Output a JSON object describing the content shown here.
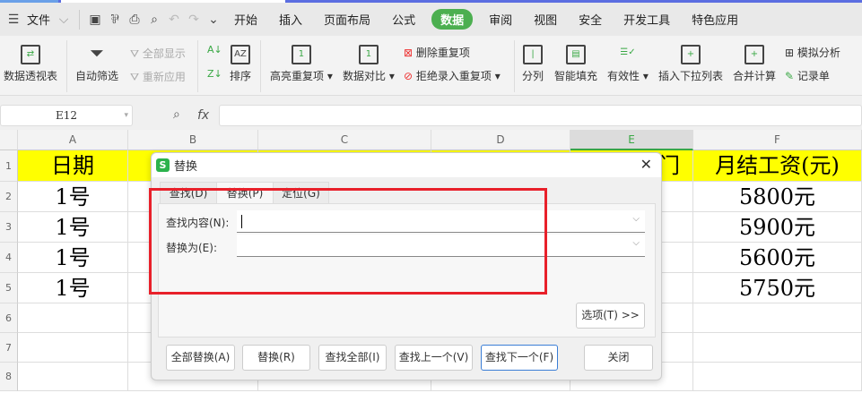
{
  "menubar": {
    "file": "文件",
    "tabs": [
      "开始",
      "插入",
      "页面布局",
      "公式",
      "数据",
      "审阅",
      "视图",
      "安全",
      "开发工具",
      "特色应用"
    ],
    "active": "数据"
  },
  "ribbon": {
    "pivot": "数据透视表",
    "autofilter": "自动筛选",
    "show_all": "全部显示",
    "reapply": "重新应用",
    "sort": "排序",
    "highlight_dup": "高亮重复项",
    "compare": "数据对比",
    "remove_dup": "删除重复项",
    "reject_dup": "拒绝录入重复项",
    "split": "分列",
    "smart_fill": "智能填充",
    "validity": "有效性",
    "insert_dropdown": "插入下拉列表",
    "consolidate": "合并计算",
    "whatif": "模拟分析",
    "record": "记录单"
  },
  "formula_bar": {
    "name_box": "E12",
    "fx": "fx",
    "value": ""
  },
  "sheet": {
    "columns": [
      "A",
      "B",
      "C",
      "D",
      "E",
      "F"
    ],
    "rows": [
      "1",
      "2",
      "3",
      "4",
      "5",
      "6",
      "7",
      "8"
    ],
    "A": [
      "日期",
      "1号",
      "1号",
      "1号",
      "1号"
    ],
    "E1": "门",
    "F": [
      "月结工资(元)",
      "5800元",
      "5900元",
      "5600元",
      "5750元"
    ]
  },
  "dialog": {
    "title": "替换",
    "tabs": [
      "查找(D)",
      "替换(P)",
      "定位(G)"
    ],
    "find_label": "查找内容(N):",
    "find_value": "",
    "replace_label": "替换为(E):",
    "replace_value": "",
    "options": "选项(T) >>",
    "buttons": [
      "全部替换(A)",
      "替换(R)",
      "查找全部(I)",
      "查找上一个(V)",
      "查找下一个(F)",
      "关闭"
    ]
  },
  "colors": {
    "accent": "#4caf50",
    "highlight": "#ffff00",
    "annotation": "#e8202a"
  }
}
